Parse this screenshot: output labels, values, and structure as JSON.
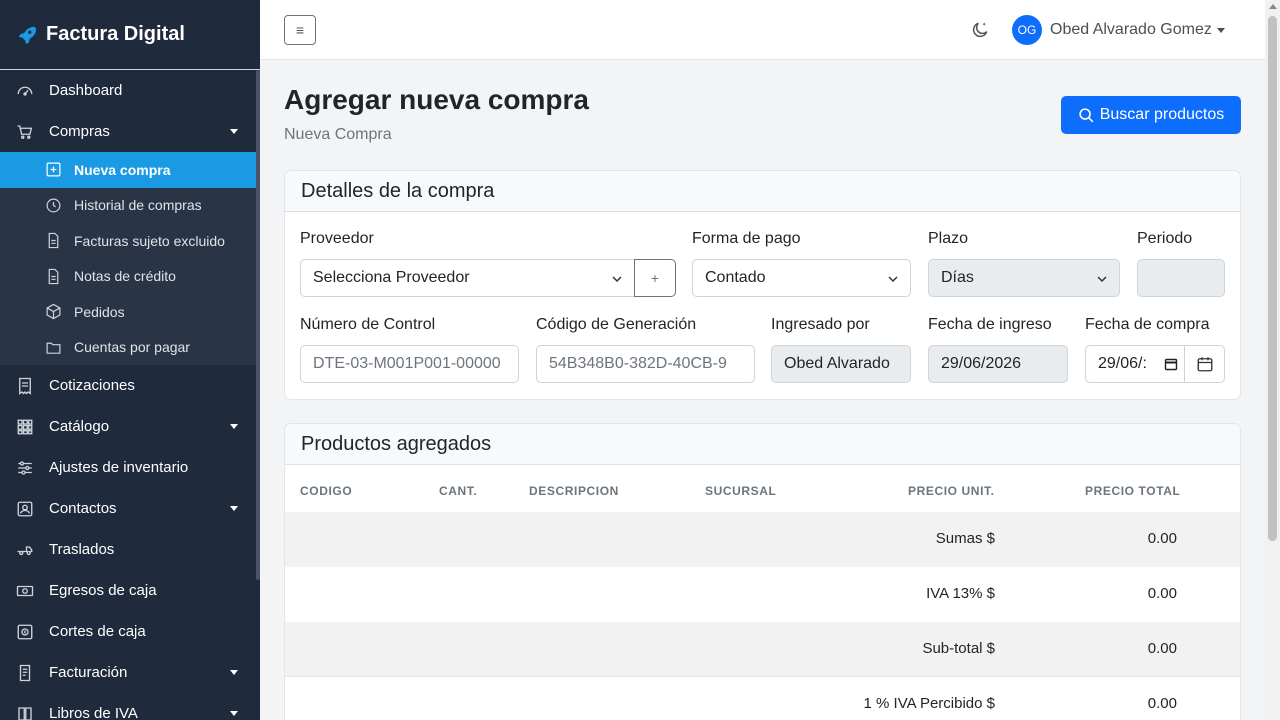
{
  "app": {
    "brand": "Factura Digital"
  },
  "sidebar": {
    "items": [
      {
        "label": "Dashboard",
        "icon": "dashboard-icon"
      },
      {
        "label": "Compras",
        "icon": "cart-icon",
        "expanded": true
      },
      {
        "label": "Cotizaciones",
        "icon": "receipt-icon"
      },
      {
        "label": "Catálogo",
        "icon": "grid-icon"
      },
      {
        "label": "Ajustes de inventario",
        "icon": "sliders-icon"
      },
      {
        "label": "Contactos",
        "icon": "contact-icon"
      },
      {
        "label": "Traslados",
        "icon": "truck-icon"
      },
      {
        "label": "Egresos de caja",
        "icon": "cash-icon"
      },
      {
        "label": "Cortes de caja",
        "icon": "cash-register-icon"
      },
      {
        "label": "Facturación",
        "icon": "invoice-icon"
      },
      {
        "label": "Libros de IVA",
        "icon": "book-icon"
      }
    ],
    "compras_sub": [
      {
        "label": "Nueva compra",
        "icon": "plus-square-icon",
        "active": true
      },
      {
        "label": "Historial de compras",
        "icon": "clock-icon"
      },
      {
        "label": "Facturas sujeto excluido",
        "icon": "document-icon"
      },
      {
        "label": "Notas de crédito",
        "icon": "document-icon"
      },
      {
        "label": "Pedidos",
        "icon": "box-icon"
      },
      {
        "label": "Cuentas por pagar",
        "icon": "folder-icon"
      }
    ]
  },
  "topbar": {
    "menu_glyph": "≡",
    "user_initials": "OG",
    "user_name": "Obed Alvarado Gomez"
  },
  "page": {
    "title": "Agregar nueva compra",
    "subtitle": "Nueva Compra",
    "search_button": "Buscar productos"
  },
  "details": {
    "title": "Detalles de la compra",
    "proveedor_label": "Proveedor",
    "proveedor_value": "Selecciona Proveedor",
    "add_glyph": "+",
    "forma_pago_label": "Forma de pago",
    "forma_pago_value": "Contado",
    "plazo_label": "Plazo",
    "plazo_value": "Días",
    "periodo_label": "Periodo",
    "periodo_value": "",
    "numero_control_label": "Número de Control",
    "numero_control_value": "DTE-03-M001P001-00000",
    "codigo_gen_label": "Código de Generación",
    "codigo_gen_value": "54B348B0-382D-40CB-9",
    "ingresado_label": "Ingresado por",
    "ingresado_value": "Obed Alvarado",
    "fecha_ingreso_label": "Fecha de ingreso",
    "fecha_ingreso_value": "29/06/2026",
    "fecha_compra_label": "Fecha de compra",
    "fecha_compra_value": "29/06/:"
  },
  "products": {
    "title": "Productos agregados",
    "columns": [
      "CODIGO",
      "CANT.",
      "DESCRIPCION",
      "SUCURSAL",
      "PRECIO UNIT.",
      "PRECIO TOTAL"
    ],
    "totals": [
      {
        "label": "Sumas $",
        "value": "0.00"
      },
      {
        "label": "IVA 13% $",
        "value": "0.00"
      },
      {
        "label": "Sub-total $",
        "value": "0.00"
      },
      {
        "label": "1 % IVA Percibido $",
        "value": "0.00"
      }
    ]
  },
  "colors": {
    "sidebar": "#1f2a3c",
    "active": "#1b9ae4",
    "primary": "#0d6efd"
  }
}
